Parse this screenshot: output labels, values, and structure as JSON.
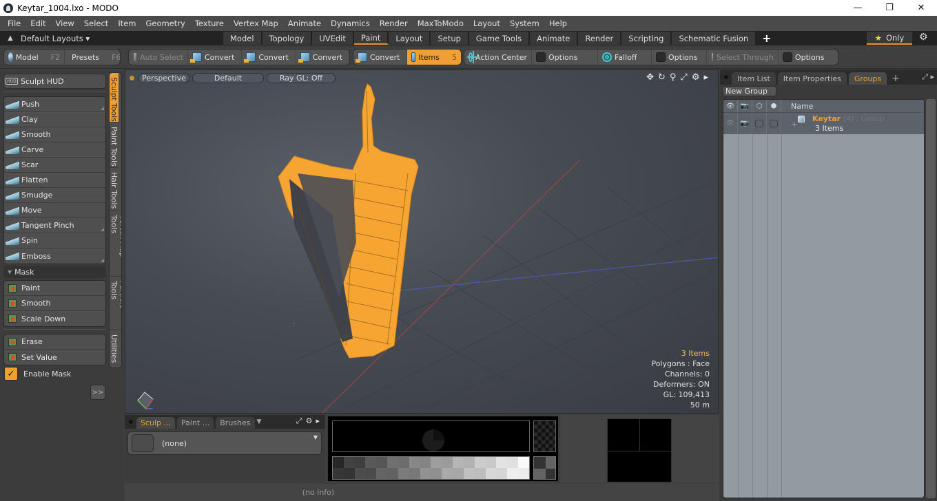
{
  "window": {
    "title": "Keytar_1004.lxo - MODO",
    "minimize": "—",
    "maximize": "❐",
    "close": "✕"
  },
  "menu": [
    "File",
    "Edit",
    "View",
    "Select",
    "Item",
    "Geometry",
    "Texture",
    "Vertex Map",
    "Animate",
    "Dynamics",
    "Render",
    "MaxToModo",
    "Layout",
    "System",
    "Help"
  ],
  "layoutbar": {
    "layouts_label": "Default Layouts ▾",
    "tabs": [
      "Model",
      "Topology",
      "UVEdit",
      "Paint",
      "Layout",
      "Setup",
      "Game Tools",
      "Animate",
      "Render",
      "Scripting",
      "Schematic Fusion"
    ],
    "active_tab": "Paint",
    "add_tab": "+",
    "only_label": "Only",
    "star": "★",
    "gear": "⚙"
  },
  "toolbar": {
    "model": {
      "label": "Model",
      "key": "F2"
    },
    "presets": {
      "label": "Presets",
      "key": "F6"
    },
    "auto_select": "Auto Select",
    "convert_1": "Convert",
    "convert_2": "Convert",
    "convert_3": "Convert",
    "convert_4": "Convert",
    "items": {
      "label": "Items",
      "count": "5"
    },
    "action_center": "Action Center",
    "options_1": "Options",
    "falloff": "Falloff",
    "options_2": "Options",
    "select_through": "Select Through",
    "options_3": "Options"
  },
  "left_panel": {
    "sculpt_hud": "Sculpt HUD",
    "hud_icon": "HUD",
    "sculpt_tools": [
      "Push",
      "Clay",
      "Smooth",
      "Carve",
      "Scar",
      "Flatten",
      "Smudge",
      "Move",
      "Tangent Pinch",
      "Spin",
      "Emboss"
    ],
    "mask_header": "Mask",
    "mask_tools": [
      "Paint",
      "Smooth",
      "Scale Down"
    ],
    "mask_tools_2": [
      "Erase",
      "Set Value"
    ],
    "enable_mask": {
      "label": "Enable Mask",
      "checked": true,
      "check": "✓"
    },
    "more": ">>",
    "vertical_tabs": [
      "Sculpt Tools",
      "Paint Tools",
      "Hair Tools",
      "Vertex Map Tools",
      "Particle Tools",
      "Utilities"
    ],
    "active_vertical_tab": "Sculpt Tools"
  },
  "viewport": {
    "view": "Perspective",
    "shading": "Default",
    "raygl": "Ray GL: Off",
    "icons": {
      "move": "✥",
      "rotate": "↻",
      "zoom": "⚲",
      "maximize": "⤢",
      "gear": "⚙",
      "more": "▸"
    },
    "grid_label": "-7",
    "info": {
      "items": "3 Items",
      "polygons": "Polygons : Face",
      "channels": "Channels: 0",
      "deformers": "Deformers: ON",
      "gl": "GL: 109,413",
      "scale": "50 m"
    },
    "model_color": "#f7a532"
  },
  "right_panel": {
    "tabs": [
      "Item List",
      "Item Properties",
      "Groups"
    ],
    "active_tab": "Groups",
    "add_tab": "+",
    "new_group": "New Group",
    "columns": {
      "name": "Name"
    },
    "groups": [
      {
        "name": "Keytar",
        "count": "(4)",
        "type": ": Group",
        "sub": "3 Items",
        "expand": "+"
      }
    ]
  },
  "bottom_panel": {
    "tabs": [
      "Sculp ...",
      "Paint ...",
      "Brushes"
    ],
    "active_tab": "Sculp ...",
    "preset_value": "(none)"
  },
  "status": {
    "text": "(no info)"
  }
}
